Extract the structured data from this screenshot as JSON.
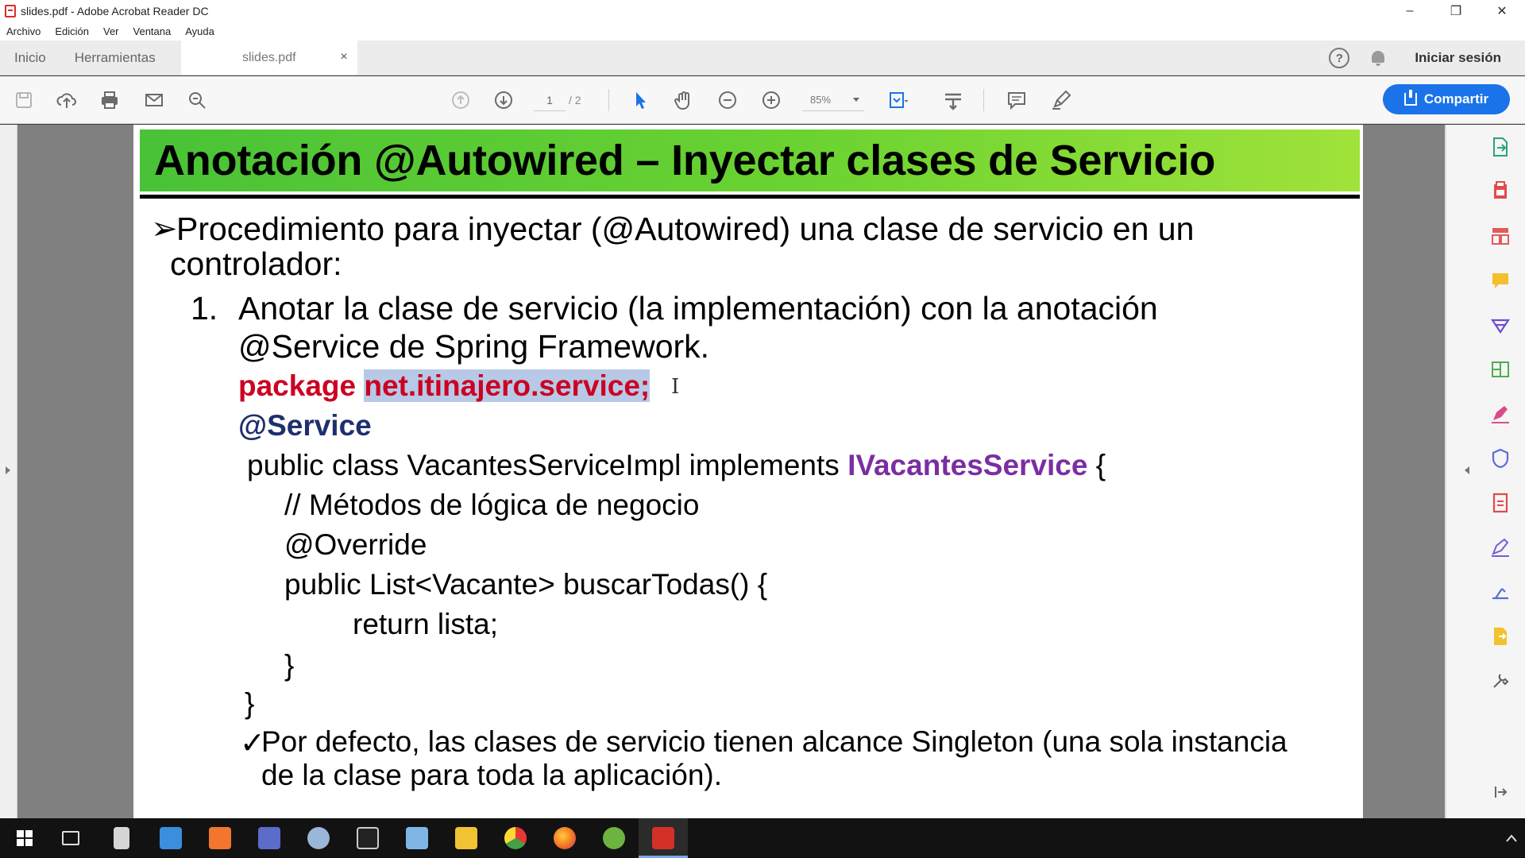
{
  "window": {
    "title": "slides.pdf - Adobe Acrobat Reader DC",
    "controls": [
      "–",
      "❐",
      "✕"
    ]
  },
  "menu": [
    "Archivo",
    "Edición",
    "Ver",
    "Ventana",
    "Ayuda"
  ],
  "tabs": {
    "home": "Inicio",
    "tools": "Herramientas",
    "document": "slides.pdf",
    "close": "×"
  },
  "account": {
    "help": "?",
    "sign_in": "Iniciar sesión"
  },
  "toolbar": {
    "page_current": "1",
    "page_total": "/ 2",
    "zoom": "85%",
    "share_label": "Compartir",
    "accent": "#1a73e8"
  },
  "slide": {
    "title": "Anotación @Autowired – Inyectar clases de Servicio",
    "bullet_marker": "➢",
    "bullet_line1": "Procedimiento para inyectar (@Autowired) una clase de servicio en un",
    "bullet_line2": "controlador:",
    "step_number": "1.",
    "step_line1": "Anotar la clase de servicio (la implementación) con la anotación",
    "step_line2": "@Service de Spring Framework.",
    "code": {
      "package_kw": "package",
      "package_name": "net.itinajero.service;",
      "annotation": "@Service",
      "class_decl_prefix": "public class VacantesServiceImpl implements",
      "interface_name": "IVacantesService",
      "class_open": "{",
      "comment": "// Métodos de lógica de negocio",
      "override": "@Override",
      "method_decl": "public List<Vacante> buscarTodas() {",
      "return_stmt": "return lista;",
      "method_close": "}",
      "class_close": "}"
    },
    "note_marker": "✓",
    "note_line1": "Por defecto, las clases de servicio tienen alcance Singleton (una sola instancia",
    "note_line2": "de la clase para toda la aplicación).",
    "header_color": "#5fcb33"
  },
  "right_tools": [
    "export-pdf-icon",
    "create-pdf-icon",
    "organize-pages-icon",
    "comment-icon",
    "combine-files-icon",
    "edit-pdf-icon",
    "fill-sign-icon",
    "protect-icon",
    "send-for-signature-icon",
    "sign-icon",
    "measure-icon",
    "send-files-icon",
    "more-tools-icon"
  ],
  "taskbar": {
    "apps": [
      "windows-start-icon",
      "task-view-icon",
      "calculator-icon",
      "mail-icon",
      "xampp-icon",
      "network-icon",
      "paint-icon",
      "terminal-icon",
      "notepad-icon",
      "file-explorer-icon",
      "chrome-icon",
      "firefox-icon",
      "spring-tool-suite-icon",
      "acrobat-icon"
    ]
  }
}
